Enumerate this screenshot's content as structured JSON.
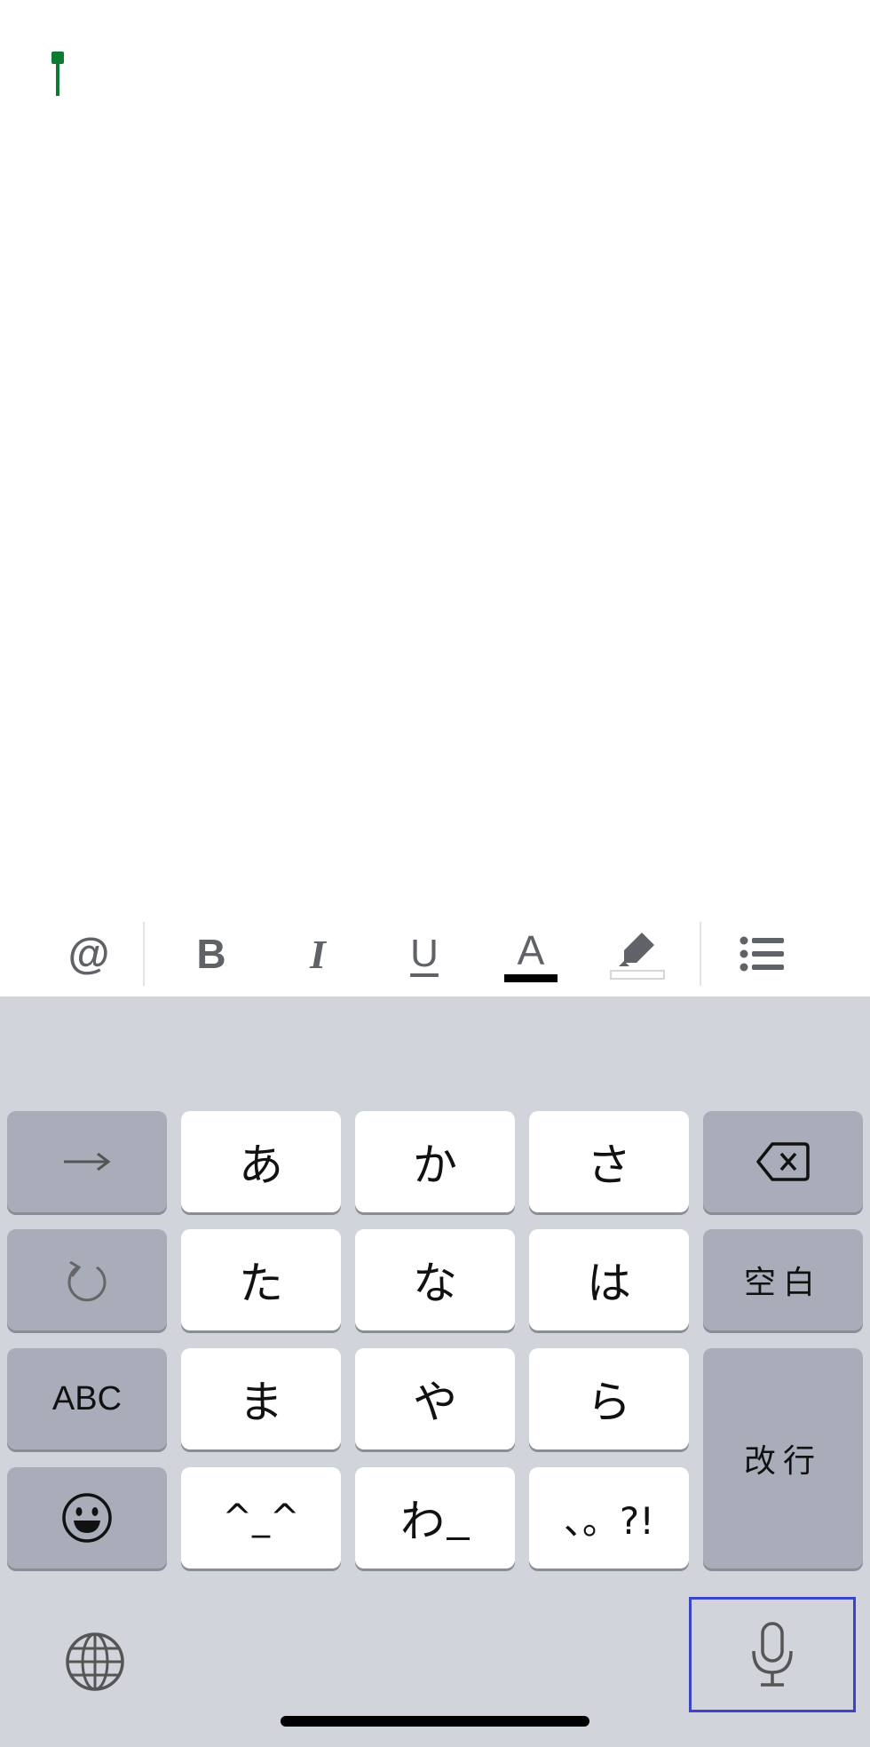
{
  "toolbar": {
    "icons": [
      "at-icon",
      "bold-icon",
      "italic-icon",
      "underline-icon",
      "text-color-icon",
      "highlight-icon",
      "bulleted-list-icon"
    ],
    "bold_label": "B",
    "italic_label": "I",
    "underline_label": "U",
    "text_color_label": "A"
  },
  "keyboard": {
    "rows": [
      [
        "→",
        "あ",
        "か",
        "さ",
        "⌫"
      ],
      [
        "↺",
        "た",
        "な",
        "は",
        "空白"
      ],
      [
        "ABC",
        "ま",
        "や",
        "ら",
        "改行"
      ],
      [
        "☺",
        "^_^",
        "わ_",
        "、。?!"
      ]
    ],
    "key_a": "あ",
    "key_ka": "か",
    "key_sa": "さ",
    "key_ta": "た",
    "key_na": "な",
    "key_ha": "は",
    "key_space": "空白",
    "key_abc": "ABC",
    "key_ma": "ま",
    "key_ya": "や",
    "key_ra": "ら",
    "key_return": "改行",
    "key_kaomoji": "^_^",
    "key_wa": "わ",
    "key_punct": "、。?!"
  },
  "colors": {
    "cursor": "#0f7a34",
    "keyboard_bg": "#d1d4db",
    "key_light": "#ffffff",
    "key_dark": "#a8adb9",
    "mic_highlight": "#3a44c6"
  }
}
